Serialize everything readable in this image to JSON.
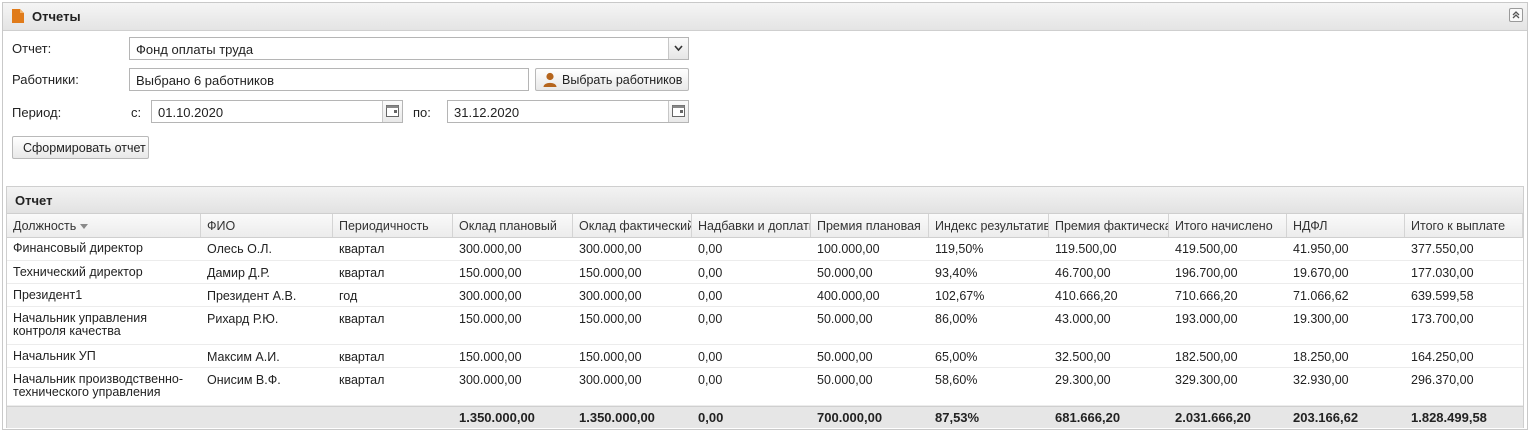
{
  "panel": {
    "title": "Отчеты"
  },
  "form": {
    "report_label": "Отчет:",
    "report_value": "Фонд оплаты труда",
    "workers_label": "Работники:",
    "workers_value": "Выбрано 6 работников",
    "select_workers_button": "Выбрать работников",
    "period_label": "Период:",
    "from_label": "с:",
    "from_value": "01.10.2020",
    "to_label": "по:",
    "to_value": "31.12.2020",
    "generate_button": "Сформировать отчет"
  },
  "grid": {
    "title": "Отчет",
    "columns": [
      "Должность",
      "ФИО",
      "Периодичность",
      "Оклад плановый",
      "Оклад фактический",
      "Надбавки и доплаты",
      "Премия плановая",
      "Индекс результативности",
      "Премия фактическая",
      "Итого начислено",
      "НДФЛ",
      "Итого к выплате"
    ],
    "rows": [
      [
        "Финансовый директор",
        "Олесь О.Л.",
        "квартал",
        "300.000,00",
        "300.000,00",
        "0,00",
        "100.000,00",
        "119,50%",
        "119.500,00",
        "419.500,00",
        "41.950,00",
        "377.550,00"
      ],
      [
        "Технический директор",
        "Дамир Д.Р.",
        "квартал",
        "150.000,00",
        "150.000,00",
        "0,00",
        "50.000,00",
        "93,40%",
        "46.700,00",
        "196.700,00",
        "19.670,00",
        "177.030,00"
      ],
      [
        "Президент1",
        "Президент А.В.",
        "год",
        "300.000,00",
        "300.000,00",
        "0,00",
        "400.000,00",
        "102,67%",
        "410.666,20",
        "710.666,20",
        "71.066,62",
        "639.599,58"
      ],
      [
        "Начальник управления контроля качества",
        "Рихард Р.Ю.",
        "квартал",
        "150.000,00",
        "150.000,00",
        "0,00",
        "50.000,00",
        "86,00%",
        "43.000,00",
        "193.000,00",
        "19.300,00",
        "173.700,00"
      ],
      [
        "Начальник УП",
        "Максим А.И.",
        "квартал",
        "150.000,00",
        "150.000,00",
        "0,00",
        "50.000,00",
        "65,00%",
        "32.500,00",
        "182.500,00",
        "18.250,00",
        "164.250,00"
      ],
      [
        "Начальник производственно-технического управления",
        "Онисим В.Ф.",
        "квартал",
        "300.000,00",
        "300.000,00",
        "0,00",
        "50.000,00",
        "58,60%",
        "29.300,00",
        "329.300,00",
        "32.930,00",
        "296.370,00"
      ]
    ],
    "totals": [
      "",
      "",
      "",
      "1.350.000,00",
      "1.350.000,00",
      "0,00",
      "700.000,00",
      "87,53%",
      "681.666,20",
      "2.031.666,20",
      "203.166,62",
      "1.828.499,58"
    ]
  },
  "colors": {
    "header_bg": "#e8e8e8",
    "total_bg": "#e6e6e6",
    "icon_orange": "#e07b1a",
    "user_icon": "#b5651d"
  },
  "icons": {
    "panel": "document-icon",
    "collapse": "double-chevron-up-icon",
    "combo": "chevron-down-icon",
    "date": "calendar-icon",
    "user": "user-icon"
  }
}
